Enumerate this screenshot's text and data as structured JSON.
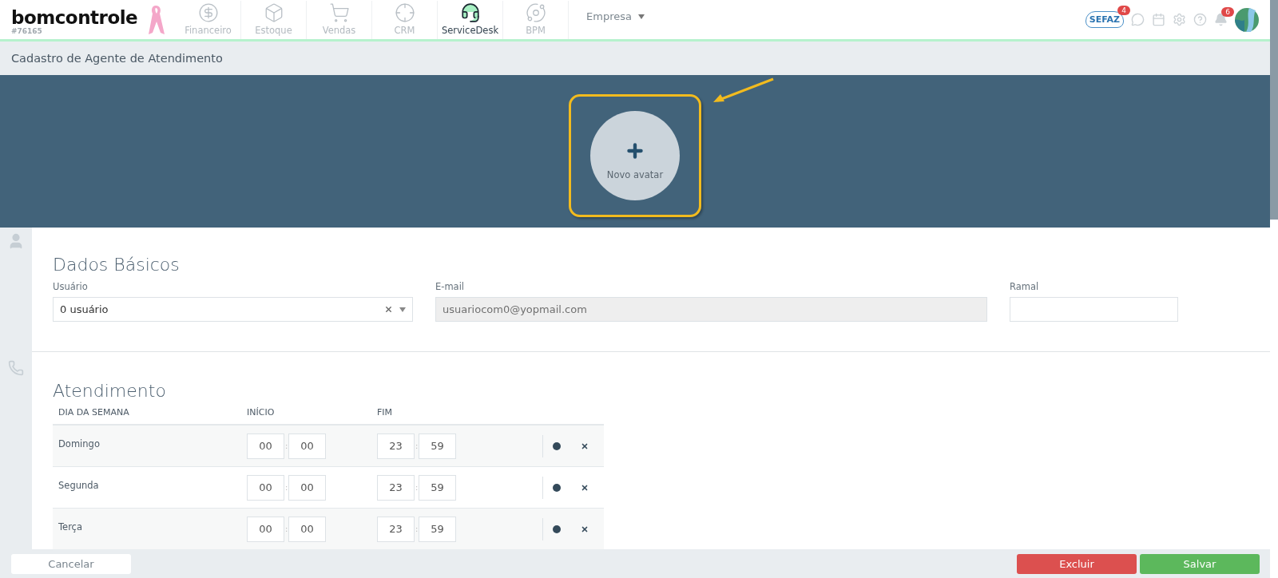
{
  "header": {
    "logo": "bomcontrole",
    "account_id": "#76165",
    "modules": [
      {
        "label": "Financeiro",
        "kind": "finance",
        "selected": false
      },
      {
        "label": "Estoque",
        "kind": "stock",
        "selected": false
      },
      {
        "label": "Vendas",
        "kind": "sales",
        "selected": false
      },
      {
        "label": "CRM",
        "kind": "crm",
        "selected": false
      },
      {
        "label": "ServiceDesk",
        "kind": "service",
        "selected": true
      },
      {
        "label": "BPM",
        "kind": "bpm",
        "selected": false
      }
    ],
    "company_menu": "Empresa",
    "sefaz": {
      "label": "SEFAZ",
      "count": "4"
    },
    "notifications": {
      "count": "6"
    }
  },
  "page_title": "Cadastro de Agente de Atendimento",
  "avatar": {
    "label": "Novo avatar"
  },
  "basic_data": {
    "title": "Dados Básicos",
    "fields": [
      {
        "label": "Usuário",
        "kind": "select",
        "value": "0 usuário",
        "disabled": false
      },
      {
        "label": "E-mail",
        "kind": "text",
        "value": "usuariocom0@yopmail.com",
        "disabled": true
      },
      {
        "label": "Ramal",
        "kind": "text",
        "disabled": false
      }
    ]
  },
  "schedule": {
    "title": "Atendimento",
    "columns": [
      "DIA DA SEMANA",
      "INÍCIO",
      "FIM"
    ],
    "rows": [
      {
        "day": "Domingo",
        "start": {
          "hour": "00",
          "separator": ":",
          "minute": "00"
        },
        "end": {
          "hour": "23",
          "separator": ":",
          "minute": "59"
        }
      },
      {
        "day": "Segunda",
        "start": {
          "hour": "00",
          "separator": ":",
          "minute": "00"
        },
        "end": {
          "hour": "23",
          "separator": ":",
          "minute": "59"
        }
      },
      {
        "day": "Terça",
        "start": {
          "hour": "00",
          "separator": ":",
          "minute": "00"
        },
        "end": {
          "hour": "23",
          "separator": ":",
          "minute": "59"
        }
      }
    ]
  },
  "footer": {
    "buttons": [
      {
        "label": "Cancelar",
        "kind": "cancel"
      },
      {
        "label": "Excluir",
        "kind": "delete"
      },
      {
        "label": "Salvar",
        "kind": "save"
      }
    ]
  }
}
